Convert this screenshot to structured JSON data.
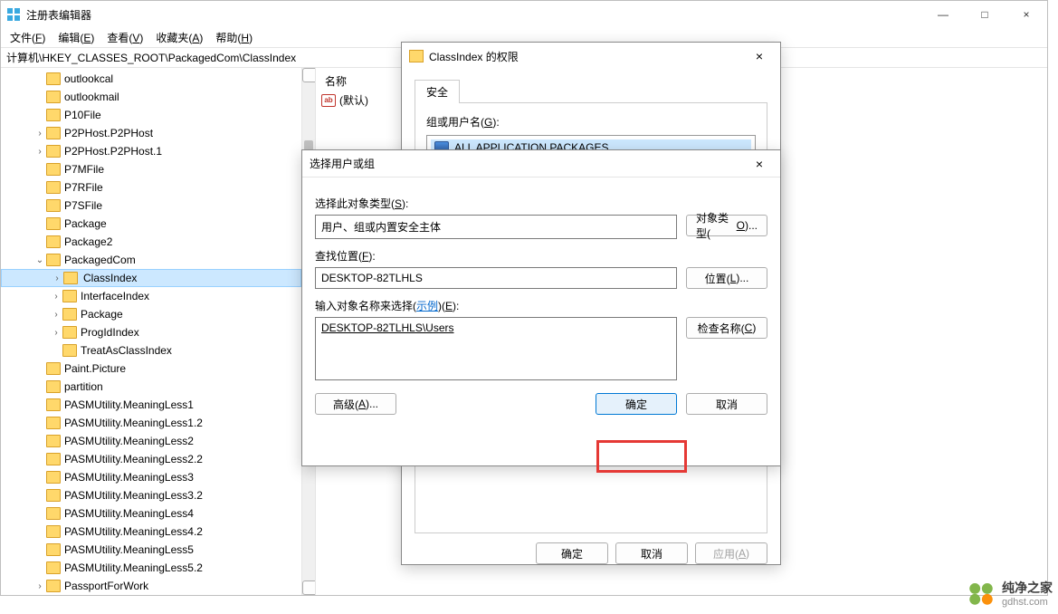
{
  "window": {
    "title": "注册表编辑器",
    "min": "—",
    "max": "□",
    "close": "×"
  },
  "menu": {
    "file": "文件(F)",
    "edit": "编辑(E)",
    "view": "查看(V)",
    "fav": "收藏夹(A)",
    "help": "帮助(H)"
  },
  "addressbar": "计算机\\HKEY_CLASSES_ROOT\\PackagedCom\\ClassIndex",
  "tree": {
    "items": [
      {
        "indent": 2,
        "exp": "",
        "label": "outlookcal"
      },
      {
        "indent": 2,
        "exp": "",
        "label": "outlookmail"
      },
      {
        "indent": 2,
        "exp": "",
        "label": "P10File"
      },
      {
        "indent": 2,
        "exp": ">",
        "label": "P2PHost.P2PHost"
      },
      {
        "indent": 2,
        "exp": ">",
        "label": "P2PHost.P2PHost.1"
      },
      {
        "indent": 2,
        "exp": "",
        "label": "P7MFile"
      },
      {
        "indent": 2,
        "exp": "",
        "label": "P7RFile"
      },
      {
        "indent": 2,
        "exp": "",
        "label": "P7SFile"
      },
      {
        "indent": 2,
        "exp": "",
        "label": "Package"
      },
      {
        "indent": 2,
        "exp": "",
        "label": "Package2"
      },
      {
        "indent": 2,
        "exp": "v",
        "label": "PackagedCom"
      },
      {
        "indent": 3,
        "exp": ">",
        "label": "ClassIndex",
        "selected": true
      },
      {
        "indent": 3,
        "exp": ">",
        "label": "InterfaceIndex"
      },
      {
        "indent": 3,
        "exp": ">",
        "label": "Package"
      },
      {
        "indent": 3,
        "exp": ">",
        "label": "ProgIdIndex"
      },
      {
        "indent": 3,
        "exp": "",
        "label": "TreatAsClassIndex"
      },
      {
        "indent": 2,
        "exp": "",
        "label": "Paint.Picture"
      },
      {
        "indent": 2,
        "exp": "",
        "label": "partition"
      },
      {
        "indent": 2,
        "exp": "",
        "label": "PASMUtility.MeaningLess1"
      },
      {
        "indent": 2,
        "exp": "",
        "label": "PASMUtility.MeaningLess1.2"
      },
      {
        "indent": 2,
        "exp": "",
        "label": "PASMUtility.MeaningLess2"
      },
      {
        "indent": 2,
        "exp": "",
        "label": "PASMUtility.MeaningLess2.2"
      },
      {
        "indent": 2,
        "exp": "",
        "label": "PASMUtility.MeaningLess3"
      },
      {
        "indent": 2,
        "exp": "",
        "label": "PASMUtility.MeaningLess3.2"
      },
      {
        "indent": 2,
        "exp": "",
        "label": "PASMUtility.MeaningLess4"
      },
      {
        "indent": 2,
        "exp": "",
        "label": "PASMUtility.MeaningLess4.2"
      },
      {
        "indent": 2,
        "exp": "",
        "label": "PASMUtility.MeaningLess5"
      },
      {
        "indent": 2,
        "exp": "",
        "label": "PASMUtility.MeaningLess5.2"
      },
      {
        "indent": 2,
        "exp": ">",
        "label": "PassportForWork"
      }
    ]
  },
  "rightpane": {
    "col_name": "名称",
    "default_value": "(默认)"
  },
  "perm": {
    "title": "ClassIndex 的权限",
    "tab": "安全",
    "group_label": "组或用户名(G):",
    "group_item": "ALL APPLICATION PACKAGES",
    "ok": "确定",
    "cancel": "取消",
    "apply": "应用(A)"
  },
  "seldlg": {
    "title": "选择用户或组",
    "objtype_lbl": "选择此对象类型(S):",
    "objtype_val": "用户、组或内置安全主体",
    "objtype_btn": "对象类型(O)...",
    "loc_lbl": "查找位置(F):",
    "loc_val": "DESKTOP-82TLHLS",
    "loc_btn": "位置(L)...",
    "names_lbl_pre": "输入对象名称来选择(",
    "names_lbl_link": "示例",
    "names_lbl_post": ")(E):",
    "names_val": "DESKTOP-82TLHLS\\Users",
    "check_btn": "检查名称(C)",
    "adv_btn": "高级(A)...",
    "ok": "确定",
    "cancel": "取消"
  },
  "watermark": {
    "name": "纯净之家",
    "url": "gdhst.com"
  }
}
